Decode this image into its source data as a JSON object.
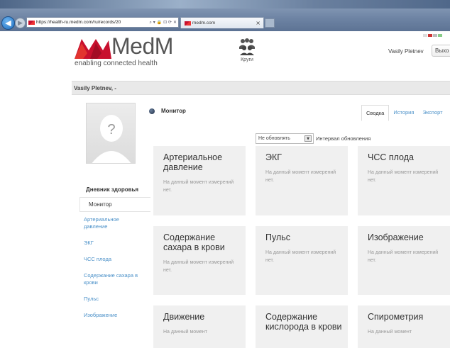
{
  "browser": {
    "url": "https://health-ru.medm.com/ru/records/20 ",
    "address_icons": "⌕ ▾ 🔒 ⊡ ⟳ ✕",
    "tab_title": "medm.com",
    "tab_close": "×"
  },
  "header": {
    "logo_text": "MedM",
    "tagline": "enabling connected health",
    "groups_label": "Круги",
    "user_name": "Vasily Pletnev",
    "logout_label": "Выхо"
  },
  "userbar": {
    "text": "Vasily Pletnev, -"
  },
  "sidebar": {
    "avatar_placeholder": "?",
    "section_title": "Дневник здоровья",
    "active_item": "Монитор",
    "items": [
      {
        "label": "Артериальное давление"
      },
      {
        "label": "ЭКГ"
      },
      {
        "label": "ЧСС плода"
      },
      {
        "label": "Содержание сахара в крови"
      },
      {
        "label": "Пульс"
      },
      {
        "label": "Изображение"
      }
    ]
  },
  "main": {
    "title": "Монитор",
    "tabs": [
      {
        "label": "Сводка"
      },
      {
        "label": "История"
      },
      {
        "label": "Экспорт"
      }
    ],
    "refresh_select_value": "Не обновлять",
    "refresh_label": "Интервал обновления",
    "cards": [
      {
        "title": "Артериальное давление",
        "note": "На данный момент измерений нет."
      },
      {
        "title": "ЭКГ",
        "note": "На данный момент измерений нет."
      },
      {
        "title": "ЧСС плода",
        "note": "На данный момент измерений нет."
      },
      {
        "title": "Содержание сахара в крови",
        "note": "На данный момент измерений нет."
      },
      {
        "title": "Пульс",
        "note": "На данный момент измерений нет."
      },
      {
        "title": "Изображение",
        "note": "На данный момент измерений нет."
      },
      {
        "title": "Движение",
        "note": "На данный момент"
      },
      {
        "title": "Содержание кислорода в крови",
        "note": ""
      },
      {
        "title": "Спирометрия",
        "note": "На данный момент"
      }
    ]
  },
  "colors": {
    "brand_red": "#c8102e",
    "link_blue": "#4a90c8",
    "card_bg": "#f0f0f0"
  }
}
